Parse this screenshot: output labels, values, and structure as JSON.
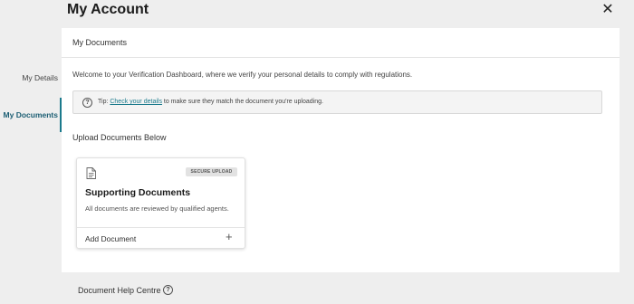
{
  "header": {
    "title": "My Account",
    "close_icon": "close-icon"
  },
  "sidebar": {
    "items": [
      {
        "label": "My Details",
        "active": false
      },
      {
        "label": "My Documents",
        "active": true
      }
    ],
    "accent_color": "#1b7a8c"
  },
  "main": {
    "section_title": "My Documents",
    "welcome_text": "Welcome to your Verification Dashboard, where we verify your personal details to comply with regulations.",
    "tip": {
      "icon": "question-circle-icon",
      "prefix": "Tip: ",
      "link_text": "Check your details",
      "suffix": " to make sure they match the document you're uploading."
    },
    "upload_heading": "Upload Documents Below",
    "card": {
      "icon": "document-icon",
      "badge": "SECURE UPLOAD",
      "title": "Supporting Documents",
      "description": "All documents are reviewed by qualified agents.",
      "action_label": "Add Document",
      "action_icon": "plus-icon"
    }
  },
  "help": {
    "label": "Document Help Centre",
    "icon": "question-circle-icon"
  }
}
